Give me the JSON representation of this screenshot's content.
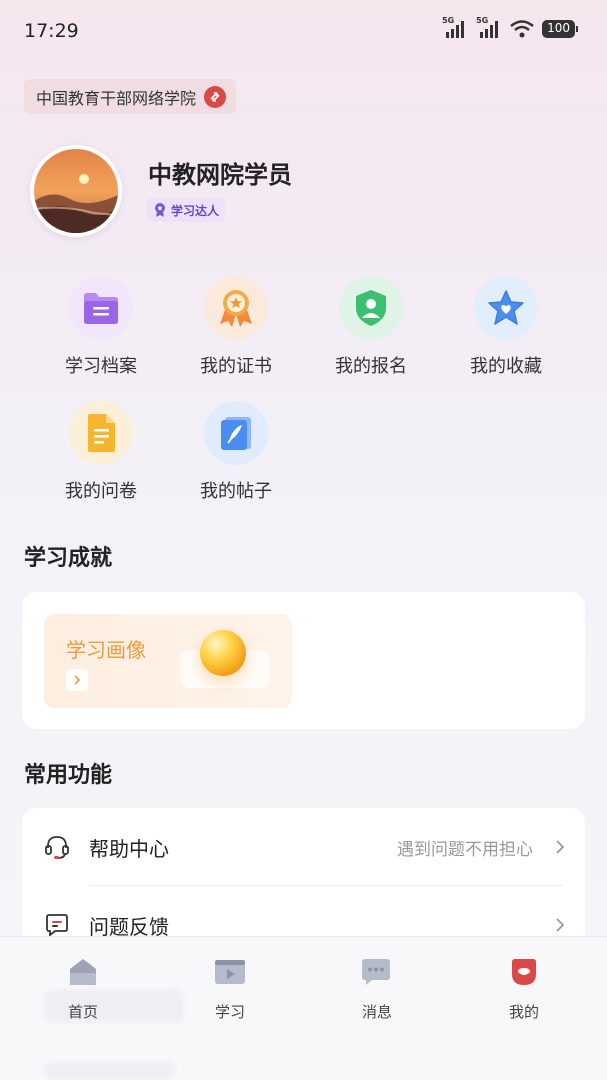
{
  "status_bar": {
    "time": "17:29",
    "battery": "100",
    "network1": "5G",
    "network2": "5G"
  },
  "header": {
    "org_name": "中国教育干部网络学院"
  },
  "profile": {
    "name": "中教网院学员",
    "badge": "学习达人"
  },
  "quick_links": [
    {
      "label": "学习档案",
      "icon": "folder-icon"
    },
    {
      "label": "我的证书",
      "icon": "medal-icon"
    },
    {
      "label": "我的报名",
      "icon": "user-shield-icon"
    },
    {
      "label": "我的收藏",
      "icon": "star-heart-icon"
    },
    {
      "label": "我的问卷",
      "icon": "document-icon"
    },
    {
      "label": "我的帖子",
      "icon": "notebook-icon"
    }
  ],
  "achievements": {
    "section_title": "学习成就",
    "portrait_title": "学习画像"
  },
  "functions": {
    "section_title": "常用功能",
    "items": [
      {
        "label": "帮助中心",
        "hint": "遇到问题不用担心",
        "icon": "headset-icon"
      },
      {
        "label": "问题反馈",
        "hint": "",
        "icon": "feedback-icon"
      }
    ]
  },
  "tabbar": {
    "items": [
      {
        "label": "首页",
        "icon": "home-icon",
        "active": false
      },
      {
        "label": "学习",
        "icon": "play-icon",
        "active": false
      },
      {
        "label": "消息",
        "icon": "message-icon",
        "active": false
      },
      {
        "label": "我的",
        "icon": "profile-icon",
        "active": true
      }
    ]
  },
  "colors": {
    "accent": "#d94a46",
    "portrait_text": "#f29a3b",
    "badge_text": "#6a47c8"
  }
}
